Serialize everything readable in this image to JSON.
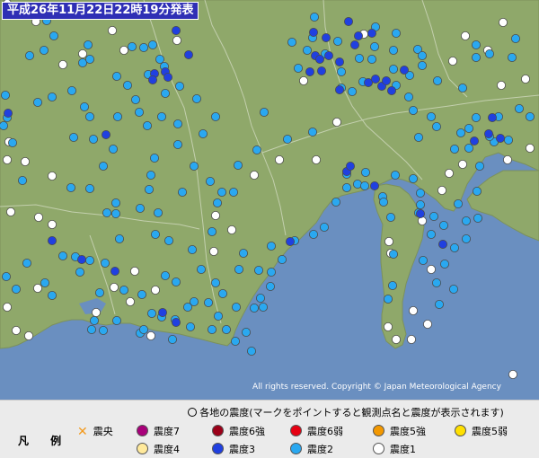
{
  "title": "平成26年11月22日22時19分発表",
  "copyright": "All rights reserved. Copyright © Japan Meteorological Agency",
  "legend": {
    "heading": "各地の震度(マークをポイントすると観測点名と震度が表示されます)",
    "label": "凡 例",
    "epicenter": "震央",
    "items": [
      {
        "label": "震度7",
        "color": "#a8007a"
      },
      {
        "label": "震度6強",
        "color": "#9b0019"
      },
      {
        "label": "震度6弱",
        "color": "#e60012"
      },
      {
        "label": "震度5強",
        "color": "#f39800"
      },
      {
        "label": "震度5弱",
        "color": "#ffe000"
      },
      {
        "label": "震度4",
        "color": "#ffe99b"
      },
      {
        "label": "震度3",
        "color": "#2040e0"
      },
      {
        "label": "震度2",
        "color": "#2aa8f0"
      },
      {
        "label": "震度1",
        "color": "#ffffff"
      }
    ]
  },
  "colors": {
    "land": "#8fa86a",
    "sea": "#6a8fc0",
    "s1": "#ffffff",
    "s2": "#2aa8f0",
    "s3": "#2040e0"
  },
  "stations": {
    "s1": [
      [
        8,
        4
      ],
      [
        40,
        24
      ],
      [
        92,
        60
      ],
      [
        70,
        72
      ],
      [
        125,
        34
      ],
      [
        138,
        56
      ],
      [
        10,
        158
      ],
      [
        8,
        178
      ],
      [
        28,
        180
      ],
      [
        58,
        196
      ],
      [
        12,
        236
      ],
      [
        43,
        242
      ],
      [
        58,
        250
      ],
      [
        42,
        321
      ],
      [
        8,
        342
      ],
      [
        18,
        368
      ],
      [
        32,
        374
      ],
      [
        127,
        320
      ],
      [
        150,
        302
      ],
      [
        173,
        323
      ],
      [
        238,
        280
      ],
      [
        258,
        256
      ],
      [
        240,
        240
      ],
      [
        311,
        178
      ],
      [
        352,
        178
      ],
      [
        283,
        195
      ],
      [
        375,
        136
      ],
      [
        338,
        90
      ],
      [
        405,
        38
      ],
      [
        504,
        68
      ],
      [
        518,
        40
      ],
      [
        543,
        56
      ],
      [
        558,
        95
      ],
      [
        585,
        88
      ],
      [
        560,
        25
      ],
      [
        590,
        165
      ],
      [
        515,
        183
      ],
      [
        500,
        193
      ],
      [
        565,
        178
      ],
      [
        492,
        212
      ],
      [
        470,
        246
      ],
      [
        433,
        269
      ],
      [
        435,
        282
      ],
      [
        460,
        346
      ],
      [
        476,
        361
      ],
      [
        458,
        378
      ],
      [
        441,
        378
      ],
      [
        432,
        364
      ],
      [
        480,
        300
      ],
      [
        168,
        374
      ],
      [
        145,
        336
      ],
      [
        571,
        417
      ],
      [
        107,
        348
      ],
      [
        197,
        45
      ]
    ],
    "s2": [
      [
        52,
        23
      ],
      [
        60,
        40
      ],
      [
        49,
        56
      ],
      [
        33,
        62
      ],
      [
        58,
        108
      ],
      [
        42,
        114
      ],
      [
        4,
        140
      ],
      [
        14,
        159
      ],
      [
        80,
        101
      ],
      [
        92,
        70
      ],
      [
        100,
        66
      ],
      [
        98,
        50
      ],
      [
        147,
        52
      ],
      [
        160,
        53
      ],
      [
        178,
        66
      ],
      [
        183,
        74
      ],
      [
        200,
        96
      ],
      [
        151,
        111
      ],
      [
        180,
        130
      ],
      [
        198,
        138
      ],
      [
        219,
        110
      ],
      [
        198,
        161
      ],
      [
        126,
        166
      ],
      [
        115,
        185
      ],
      [
        168,
        195
      ],
      [
        166,
        211
      ],
      [
        100,
        210
      ],
      [
        156,
        232
      ],
      [
        79,
        209
      ],
      [
        25,
        201
      ],
      [
        70,
        285
      ],
      [
        30,
        293
      ],
      [
        7,
        308
      ],
      [
        18,
        322
      ],
      [
        50,
        315
      ],
      [
        58,
        329
      ],
      [
        89,
        303
      ],
      [
        84,
        286
      ],
      [
        100,
        290
      ],
      [
        117,
        293
      ],
      [
        111,
        326
      ],
      [
        138,
        323
      ],
      [
        158,
        328
      ],
      [
        184,
        307
      ],
      [
        196,
        314
      ],
      [
        216,
        336
      ],
      [
        232,
        337
      ],
      [
        243,
        352
      ],
      [
        236,
        367
      ],
      [
        212,
        364
      ],
      [
        195,
        356
      ],
      [
        209,
        342
      ],
      [
        180,
        353
      ],
      [
        169,
        349
      ],
      [
        156,
        371
      ],
      [
        105,
        357
      ],
      [
        252,
        367
      ],
      [
        262,
        380
      ],
      [
        280,
        391
      ],
      [
        274,
        370
      ],
      [
        283,
        343
      ],
      [
        290,
        332
      ],
      [
        301,
        319
      ],
      [
        302,
        303
      ],
      [
        288,
        301
      ],
      [
        314,
        289
      ],
      [
        302,
        274
      ],
      [
        328,
        268
      ],
      [
        349,
        261
      ],
      [
        361,
        253
      ],
      [
        374,
        225
      ],
      [
        386,
        209
      ],
      [
        398,
        205
      ],
      [
        386,
        194
      ],
      [
        407,
        192
      ],
      [
        406,
        207
      ],
      [
        426,
        219
      ],
      [
        440,
        195
      ],
      [
        460,
        199
      ],
      [
        468,
        215
      ],
      [
        468,
        228
      ],
      [
        466,
        237
      ],
      [
        483,
        241
      ],
      [
        480,
        261
      ],
      [
        494,
        251
      ],
      [
        510,
        227
      ],
      [
        519,
        246
      ],
      [
        519,
        266
      ],
      [
        506,
        276
      ],
      [
        495,
        294
      ],
      [
        489,
        339
      ],
      [
        505,
        322
      ],
      [
        437,
        318
      ],
      [
        432,
        333
      ],
      [
        438,
        283
      ],
      [
        427,
        225
      ],
      [
        435,
        242
      ],
      [
        471,
        290
      ],
      [
        486,
        315
      ],
      [
        532,
        243
      ],
      [
        531,
        213
      ],
      [
        534,
        185
      ],
      [
        550,
        158
      ],
      [
        522,
        165
      ],
      [
        506,
        166
      ],
      [
        486,
        141
      ],
      [
        466,
        153
      ],
      [
        480,
        130
      ],
      [
        460,
        123
      ],
      [
        455,
        108
      ],
      [
        441,
        95
      ],
      [
        438,
        77
      ],
      [
        470,
        73
      ],
      [
        465,
        55
      ],
      [
        470,
        62
      ],
      [
        456,
        84
      ],
      [
        487,
        90
      ],
      [
        515,
        98
      ],
      [
        530,
        64
      ],
      [
        530,
        50
      ],
      [
        545,
        60
      ],
      [
        574,
        43
      ],
      [
        570,
        64
      ],
      [
        578,
        121
      ],
      [
        590,
        130
      ],
      [
        555,
        130
      ],
      [
        530,
        131
      ],
      [
        522,
        143
      ],
      [
        513,
        148
      ],
      [
        545,
        152
      ],
      [
        566,
        156
      ],
      [
        400,
        65
      ],
      [
        417,
        52
      ],
      [
        438,
        56
      ],
      [
        441,
        37
      ],
      [
        418,
        30
      ],
      [
        376,
        46
      ],
      [
        380,
        80
      ],
      [
        362,
        60
      ],
      [
        332,
        76
      ],
      [
        342,
        56
      ],
      [
        325,
        47
      ],
      [
        350,
        19
      ],
      [
        348,
        42
      ],
      [
        320,
        155
      ],
      [
        348,
        147
      ],
      [
        380,
        98
      ],
      [
        392,
        102
      ],
      [
        414,
        66
      ],
      [
        404,
        91
      ],
      [
        294,
        125
      ],
      [
        240,
        130
      ],
      [
        226,
        149
      ],
      [
        234,
        202
      ],
      [
        247,
        214
      ],
      [
        286,
        167
      ],
      [
        265,
        184
      ],
      [
        216,
        185
      ],
      [
        203,
        214
      ],
      [
        242,
        226
      ],
      [
        260,
        214
      ],
      [
        8,
        131
      ],
      [
        6,
        106
      ],
      [
        165,
        83
      ],
      [
        170,
        50
      ],
      [
        184,
        104
      ],
      [
        155,
        125
      ],
      [
        130,
        85
      ],
      [
        142,
        95
      ],
      [
        100,
        130
      ],
      [
        82,
        153
      ],
      [
        94,
        119
      ],
      [
        104,
        155
      ],
      [
        131,
        130
      ],
      [
        164,
        140
      ],
      [
        172,
        176
      ],
      [
        176,
        237
      ],
      [
        129,
        226
      ],
      [
        224,
        300
      ],
      [
        240,
        315
      ],
      [
        192,
        378
      ],
      [
        115,
        368
      ],
      [
        129,
        238
      ],
      [
        160,
        367
      ],
      [
        130,
        357
      ],
      [
        102,
        367
      ],
      [
        133,
        266
      ],
      [
        119,
        237
      ],
      [
        173,
        261
      ],
      [
        188,
        268
      ],
      [
        214,
        278
      ],
      [
        236,
        258
      ],
      [
        263,
        342
      ],
      [
        248,
        327
      ],
      [
        266,
        300
      ],
      [
        271,
        282
      ],
      [
        293,
        342
      ]
    ],
    "s3": [
      [
        9,
        126
      ],
      [
        118,
        150
      ],
      [
        58,
        268
      ],
      [
        91,
        289
      ],
      [
        128,
        302
      ],
      [
        196,
        359
      ],
      [
        181,
        348
      ],
      [
        172,
        82
      ],
      [
        184,
        80
      ],
      [
        187,
        86
      ],
      [
        170,
        89
      ],
      [
        196,
        34
      ],
      [
        210,
        61
      ],
      [
        363,
        42
      ],
      [
        351,
        62
      ],
      [
        345,
        80
      ],
      [
        358,
        79
      ],
      [
        388,
        24
      ],
      [
        395,
        50
      ],
      [
        399,
        40
      ],
      [
        414,
        37
      ],
      [
        378,
        69
      ],
      [
        366,
        62
      ],
      [
        356,
        66
      ],
      [
        386,
        191
      ],
      [
        390,
        185
      ],
      [
        417,
        207
      ],
      [
        493,
        272
      ],
      [
        528,
        157
      ],
      [
        548,
        131
      ],
      [
        557,
        154
      ],
      [
        544,
        149
      ],
      [
        468,
        238
      ],
      [
        410,
        92
      ],
      [
        418,
        88
      ],
      [
        425,
        96
      ],
      [
        430,
        90
      ],
      [
        436,
        101
      ],
      [
        450,
        78
      ],
      [
        378,
        100
      ],
      [
        349,
        36
      ],
      [
        323,
        269
      ]
    ]
  }
}
